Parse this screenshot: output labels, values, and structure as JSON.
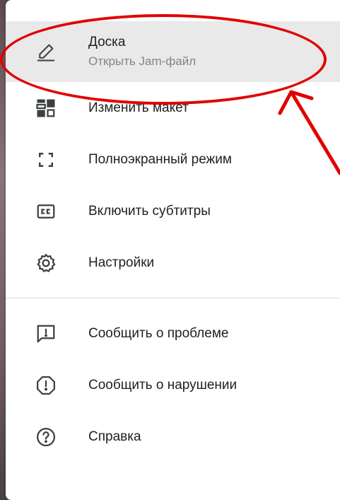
{
  "menu": {
    "items": [
      {
        "icon": "pencil-icon",
        "label": "Доска",
        "sub": "Открыть Jam-файл"
      },
      {
        "icon": "layout-icon",
        "label": "Изменить макет"
      },
      {
        "icon": "fullscreen-icon",
        "label": "Полноэкранный режим"
      },
      {
        "icon": "closed-captions-icon",
        "label": "Включить субтитры"
      },
      {
        "icon": "gear-icon",
        "label": "Настройки"
      }
    ],
    "items_bottom": [
      {
        "icon": "feedback-icon",
        "label": "Сообщить о проблеме"
      },
      {
        "icon": "report-icon",
        "label": "Сообщить о нарушении"
      },
      {
        "icon": "help-icon",
        "label": "Справка"
      }
    ]
  },
  "colors": {
    "annotation": "#e10000",
    "highlight_bg": "#e9e9ea",
    "text": "#202124",
    "subtext": "#80868b"
  }
}
